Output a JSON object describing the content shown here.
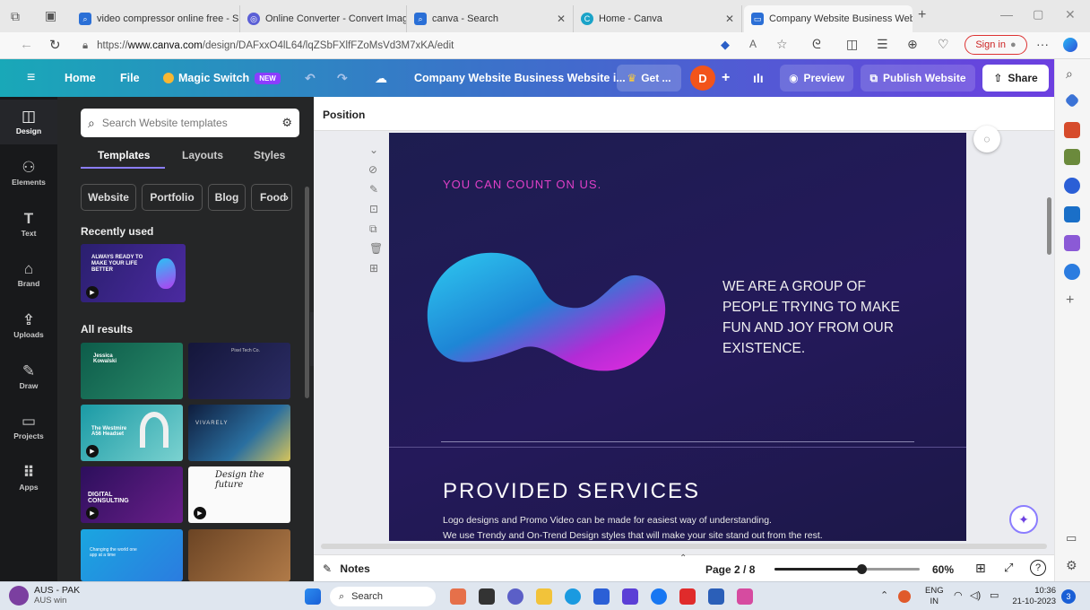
{
  "browser": {
    "tabs": [
      {
        "title": "video compressor online free - S",
        "icon": "search-icon"
      },
      {
        "title": "Online Converter - Convert Imag",
        "icon": "converter-icon"
      },
      {
        "title": "canva - Search",
        "icon": "search-icon"
      },
      {
        "title": "Home - Canva",
        "icon": "canva-icon"
      },
      {
        "title": "Company Website Business Web",
        "icon": "canva-doc-icon"
      }
    ],
    "url_prefix": "https://",
    "url_domain": "www.canva.com",
    "url_path": "/design/DAFxxO4lL64/lqZSbFXlfFZoMsVd3M7xKA/edit",
    "sign_in_label": "Sign in"
  },
  "canva_bar": {
    "home": "Home",
    "file": "File",
    "magic_switch": "Magic Switch",
    "new_badge": "NEW",
    "doc_title": "Company Website Business Website i...",
    "get_label": "Get ...",
    "avatar_letter": "D",
    "preview": "Preview",
    "publish": "Publish Website",
    "share": "Share"
  },
  "rail": [
    {
      "label": "Design",
      "icon": "design-icon",
      "glyph": "◫"
    },
    {
      "label": "Elements",
      "icon": "elements-icon",
      "glyph": "⚇"
    },
    {
      "label": "Text",
      "icon": "text-icon",
      "glyph": "T"
    },
    {
      "label": "Brand",
      "icon": "brand-icon",
      "glyph": "⌂"
    },
    {
      "label": "Uploads",
      "icon": "uploads-icon",
      "glyph": "⇪"
    },
    {
      "label": "Draw",
      "icon": "draw-icon",
      "glyph": "✎"
    },
    {
      "label": "Projects",
      "icon": "projects-icon",
      "glyph": "▭"
    },
    {
      "label": "Apps",
      "icon": "apps-icon",
      "glyph": "⠿"
    }
  ],
  "panel": {
    "search_placeholder": "Search Website templates",
    "tabs": [
      "Templates",
      "Layouts",
      "Styles"
    ],
    "chips": [
      "Website",
      "Portfolio",
      "Blog",
      "Food"
    ],
    "recently_used": "Recently used",
    "recent_thumb_text": "ALWAYS READY TO MAKE YOUR LIFE BETTER",
    "all_results": "All results",
    "thumbs": [
      {
        "caption": "Jessica Kowalski"
      },
      {
        "caption": "Pixel Tech Co."
      },
      {
        "caption": "The Westmire A56 Headset"
      },
      {
        "caption": "VIVARELY"
      },
      {
        "caption": "DIGITAL CONSULTING"
      },
      {
        "caption": "Design the future"
      },
      {
        "caption": "Changing the world one app at a time"
      },
      {
        "caption": ""
      }
    ]
  },
  "workspace": {
    "position_label": "Position",
    "tagline": "YOU CAN COUNT ON US.",
    "heading_lines": [
      "WE ARE A GROUP OF",
      "PEOPLE TRYING TO MAKE",
      "FUN AND JOY FROM OUR",
      "EXISTENCE."
    ],
    "services_title": "PROVIDED SERVICES",
    "services_line1": "Logo designs and Promo Video can be made for easiest way of understanding.",
    "services_line2": "We use Trendy and On-Trend Design styles that will make your site stand out from the rest.",
    "notes": "Notes",
    "page_indicator": "Page 2 / 8",
    "zoom": "60%",
    "zoom_fraction": 0.6
  },
  "taskbar": {
    "weather_title": "AUS - PAK",
    "weather_sub": "AUS win",
    "search": "Search",
    "lang": "ENG",
    "region": "IN",
    "time": "10:36",
    "date": "21-10-2023",
    "notification_count": "3"
  },
  "colors": {
    "canva_gradient_start": "#19a8b8",
    "canva_gradient_end": "#6c3fe0",
    "accent_pink": "#e040c8",
    "avatar": "#f2541b"
  }
}
